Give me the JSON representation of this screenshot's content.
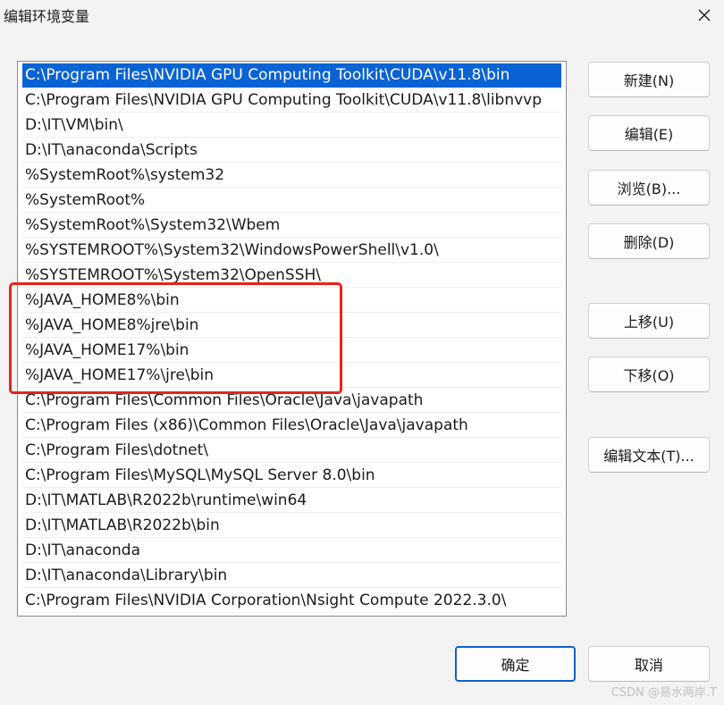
{
  "window": {
    "title": "编辑环境变量",
    "close_icon": "close-icon"
  },
  "list": {
    "items": [
      "C:\\Program Files\\NVIDIA GPU Computing Toolkit\\CUDA\\v11.8\\bin",
      "C:\\Program Files\\NVIDIA GPU Computing Toolkit\\CUDA\\v11.8\\libnvvp",
      "D:\\IT\\VM\\bin\\",
      "D:\\IT\\anaconda\\Scripts",
      "%SystemRoot%\\system32",
      "%SystemRoot%",
      "%SystemRoot%\\System32\\Wbem",
      "%SYSTEMROOT%\\System32\\WindowsPowerShell\\v1.0\\",
      "%SYSTEMROOT%\\System32\\OpenSSH\\",
      "%JAVA_HOME8%\\bin",
      "%JAVA_HOME8%jre\\bin",
      "%JAVA_HOME17%\\bin",
      "%JAVA_HOME17%\\jre\\bin",
      "C:\\Program Files\\Common Files\\Oracle\\Java\\javapath",
      "C:\\Program Files (x86)\\Common Files\\Oracle\\Java\\javapath",
      "C:\\Program Files\\dotnet\\",
      "C:\\Program Files\\MySQL\\MySQL Server 8.0\\bin",
      "D:\\IT\\MATLAB\\R2022b\\runtime\\win64",
      "D:\\IT\\MATLAB\\R2022b\\bin",
      "D:\\IT\\anaconda",
      "D:\\IT\\anaconda\\Library\\bin",
      "C:\\Program Files\\NVIDIA Corporation\\Nsight Compute 2022.3.0\\"
    ],
    "selected_index": 0
  },
  "buttons": {
    "new": "新建(N)",
    "edit": "编辑(E)",
    "browse": "浏览(B)...",
    "delete": "删除(D)",
    "move_up": "上移(U)",
    "move_down": "下移(O)",
    "edit_text": "编辑文本(T)..."
  },
  "footer": {
    "ok": "确定",
    "cancel": "取消"
  },
  "watermark": "CSDN @易水两岸.T",
  "colors": {
    "selection": "#0a63d4",
    "annotation": "#e8241b",
    "accent": "#0f63c8"
  }
}
